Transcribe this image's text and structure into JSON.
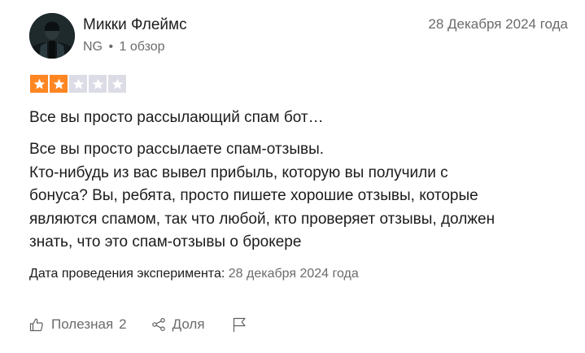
{
  "reviewer": {
    "name": "Микки Флеймс",
    "country": "NG",
    "separator": "•",
    "reviews_count": "1 обзор",
    "avatar_icon": "user-avatar-photo"
  },
  "review": {
    "date": "28 Декабря 2024 года",
    "rating": 2,
    "rating_max": 5,
    "colors": {
      "star_filled": "#ff8622",
      "star_empty": "#dcdce6"
    },
    "title": "Все вы просто рассылающий спам бот…",
    "body_lines": [
      "Все вы просто рассылаете спам-отзывы.",
      "Кто-нибудь из вас вывел прибыль, которую вы получили с",
      "бонуса? Вы, ребята, просто пишете хорошие отзывы, которые",
      "являются спамом, так что любой, кто проверяет отзывы, должен",
      "знать, что это спам-отзывы о брокере"
    ],
    "experience_label": "Дата проведения эксперимента:",
    "experience_date": "28 декабря 2024 года"
  },
  "actions": {
    "useful_label": "Полезная",
    "useful_count": "2",
    "useful_icon": "thumbs-up-icon",
    "share_label": "Доля",
    "share_icon": "share-icon",
    "report_icon": "flag-icon"
  }
}
